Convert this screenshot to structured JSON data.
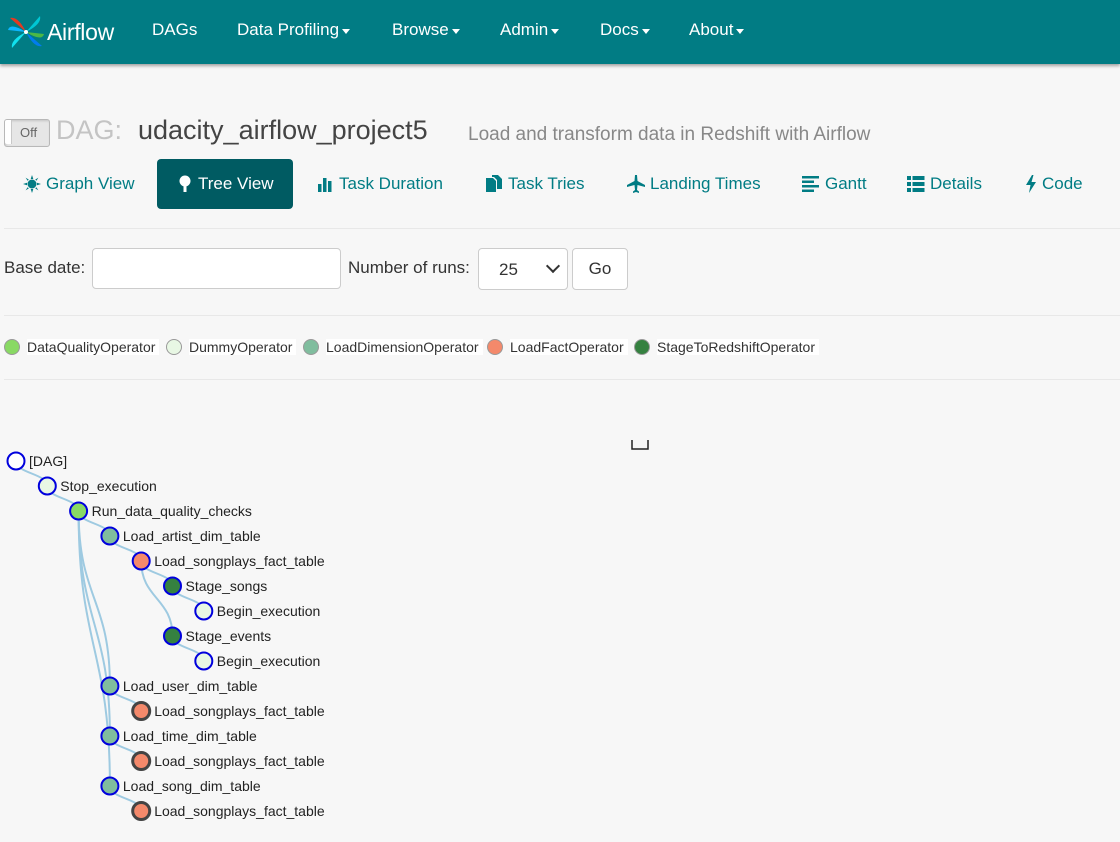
{
  "app": {
    "brand": "Airflow"
  },
  "nav": [
    {
      "label": "DAGs",
      "dropdown": false
    },
    {
      "label": "Data Profiling",
      "dropdown": true
    },
    {
      "label": "Browse",
      "dropdown": true
    },
    {
      "label": "Admin",
      "dropdown": true
    },
    {
      "label": "Docs",
      "dropdown": true
    },
    {
      "label": "About",
      "dropdown": true
    }
  ],
  "dag": {
    "toggle_label": "Off",
    "prefix": "DAG:",
    "id": "udacity_airflow_project5",
    "description": "Load and transform data in Redshift with Airflow"
  },
  "tabs": [
    {
      "label": "Graph View",
      "icon": "sun-icon",
      "active": false
    },
    {
      "label": "Tree View",
      "icon": "tree-icon",
      "active": true
    },
    {
      "label": "Task Duration",
      "icon": "bar-chart-icon",
      "active": false
    },
    {
      "label": "Task Tries",
      "icon": "files-icon",
      "active": false
    },
    {
      "label": "Landing Times",
      "icon": "plane-icon",
      "active": false
    },
    {
      "label": "Gantt",
      "icon": "align-left-icon",
      "active": false
    },
    {
      "label": "Details",
      "icon": "list-icon",
      "active": false
    },
    {
      "label": "Code",
      "icon": "flash-icon",
      "active": false
    }
  ],
  "form": {
    "base_date_label": "Base date:",
    "base_date_value": "",
    "runs_label": "Number of runs:",
    "runs_value": "25",
    "go_label": "Go"
  },
  "legend": [
    {
      "label": "DataQualityOperator",
      "color": "#89d964"
    },
    {
      "label": "DummyOperator",
      "color": "#e8f7e4"
    },
    {
      "label": "LoadDimensionOperator",
      "color": "#80bd9e"
    },
    {
      "label": "LoadFactOperator",
      "color": "#f4896b"
    },
    {
      "label": "StageToRedshiftOperator",
      "color": "#358140"
    }
  ],
  "tree": [
    {
      "label": "[DAG]",
      "depth": 0,
      "fill": "#ffffff",
      "stroke": "#0000dd"
    },
    {
      "label": "Stop_execution",
      "depth": 1,
      "fill": "#e8f7e4",
      "stroke": "#0000dd"
    },
    {
      "label": "Run_data_quality_checks",
      "depth": 2,
      "fill": "#89d964",
      "stroke": "#0000dd"
    },
    {
      "label": "Load_artist_dim_table",
      "depth": 3,
      "fill": "#80bd9e",
      "stroke": "#0000dd"
    },
    {
      "label": "Load_songplays_fact_table",
      "depth": 4,
      "fill": "#f4896b",
      "stroke": "#0000dd"
    },
    {
      "label": "Stage_songs",
      "depth": 5,
      "fill": "#358140",
      "stroke": "#0000dd"
    },
    {
      "label": "Begin_execution",
      "depth": 6,
      "fill": "#e8f7e4",
      "stroke": "#0000dd"
    },
    {
      "label": "Stage_events",
      "depth": 5,
      "fill": "#358140",
      "stroke": "#0000dd"
    },
    {
      "label": "Begin_execution",
      "depth": 6,
      "fill": "#e8f7e4",
      "stroke": "#0000dd"
    },
    {
      "label": "Load_user_dim_table",
      "depth": 3,
      "fill": "#80bd9e",
      "stroke": "#0000dd"
    },
    {
      "label": "Load_songplays_fact_table",
      "depth": 4,
      "fill": "#f4896b",
      "stroke": "#444444"
    },
    {
      "label": "Load_time_dim_table",
      "depth": 3,
      "fill": "#80bd9e",
      "stroke": "#0000dd"
    },
    {
      "label": "Load_songplays_fact_table",
      "depth": 4,
      "fill": "#f4896b",
      "stroke": "#444444"
    },
    {
      "label": "Load_song_dim_table",
      "depth": 3,
      "fill": "#80bd9e",
      "stroke": "#0000dd"
    },
    {
      "label": "Load_songplays_fact_table",
      "depth": 4,
      "fill": "#f4896b",
      "stroke": "#444444"
    }
  ]
}
